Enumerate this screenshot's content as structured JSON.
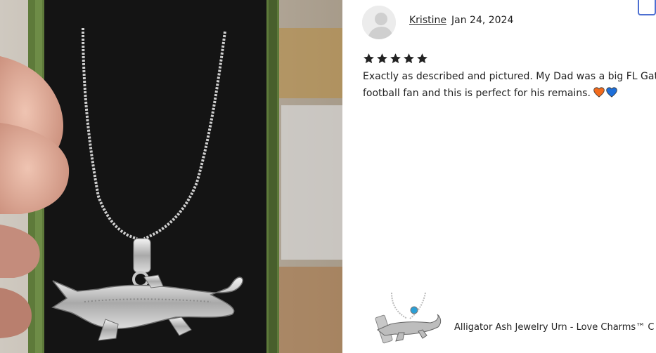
{
  "review": {
    "author": "Kristine",
    "date": "Jan 24, 2024",
    "rating": 5,
    "rating_max": 5,
    "line1": "Exactly as described and pictured. My Dad was a big FL Gator",
    "line2": "football fan and this is perfect for his remains.",
    "emojis": [
      "orange-heart-icon",
      "blue-heart-icon"
    ]
  },
  "product": {
    "name": "Alligator Ash Jewelry Urn - Love Charms™ C"
  },
  "colors": {
    "star": "#222222",
    "orange_heart": "#f26b1d",
    "blue_heart": "#1e6fd9",
    "focus_outline": "#4d6fd1",
    "box_green": "#5e7a3a",
    "velvet": "#111111"
  }
}
